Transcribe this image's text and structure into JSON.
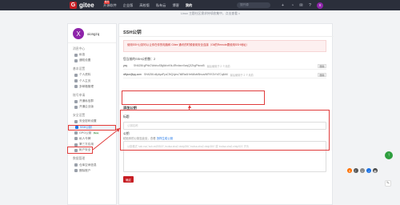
{
  "nav": {
    "logo_letter": "G",
    "logo_text": "gitee",
    "items": [
      "开源软件",
      "企业版",
      "高校版",
      "私有云",
      "博客",
      "我的"
    ],
    "badge": "推荐",
    "search_placeholder": "搜开源",
    "avatar_letter": "X",
    "icons": [
      "plus-icon",
      "bell-icon",
      "mail-icon",
      "question-icon"
    ]
  },
  "notice": "Linux 主题社区需求持续收集中，点击查看  ×",
  "sidebar": {
    "avatar_letter": "X",
    "username": "xiongzq",
    "groups": [
      {
        "title": "消息中心",
        "items": [
          "私信",
          "通知设置"
        ]
      },
      {
        "title": "基本设置",
        "items": [
          "个人资料",
          "个人主页",
          "多邮箱管理"
        ]
      },
      {
        "title": "账号申请",
        "items": [
          "开通私信群",
          "开通企业版"
        ]
      },
      {
        "title": "安全设置",
        "items": [
          "安全密码设置",
          "SSH公钥",
          "GPG公钥",
          "私人令牌",
          "第三方应用",
          "帐户安全"
        ]
      },
      {
        "title": "数据管理",
        "items": [
          "仓库空间信息",
          "删除账户"
        ]
      }
    ],
    "gpg_badge": "Beta"
  },
  "main": {
    "title": "SSH公钥",
    "info": "使用SSH公钥可以让你在你的电脑和 Gitee 通讯的时候使用安全连接（Git的Remote要使用SSH地址）",
    "added_label": "您当前的SSH公钥数：2",
    "keys": [
      {
        "name": "yzq",
        "fingerprint": "SHA256:gPhkCWwlvuS8gWcxKhL4RndwcrXwqQ2ZkgPhcxoB",
        "time": "最后使用于 2 个月前",
        "delete": "删除"
      },
      {
        "name": "xiflyun@qq.com",
        "fingerprint": "SHA256:d4ybyaPyuC9rQ4ynu7k8RaAHmWkvbBhsuvWRYKSrYd7Cq4kM",
        "time": "最后使用于 2 个月前",
        "delete": "删除"
      }
    ],
    "add_label": "添加公钥",
    "title_label": "标题",
    "title_placeholder": "公钥名称",
    "pubkey_label": "公钥",
    "pubkey_hint": "粘贴你的公钥至此处，查看 ",
    "pubkey_hint_link": "怎样生成公钥",
    "pubkey_placeholder": "公钥格式 'ssh-rsa','ssh-ed25519','ecdsa-sha2-nistp256','ecdsa-sha2-nistp384' 或 'ecdsa-sha2-nistp521' 开头",
    "submit": "确定"
  },
  "colors": {
    "brand": "#c71d23",
    "annotation": "#e03c3c",
    "link": "#1a73e8"
  }
}
